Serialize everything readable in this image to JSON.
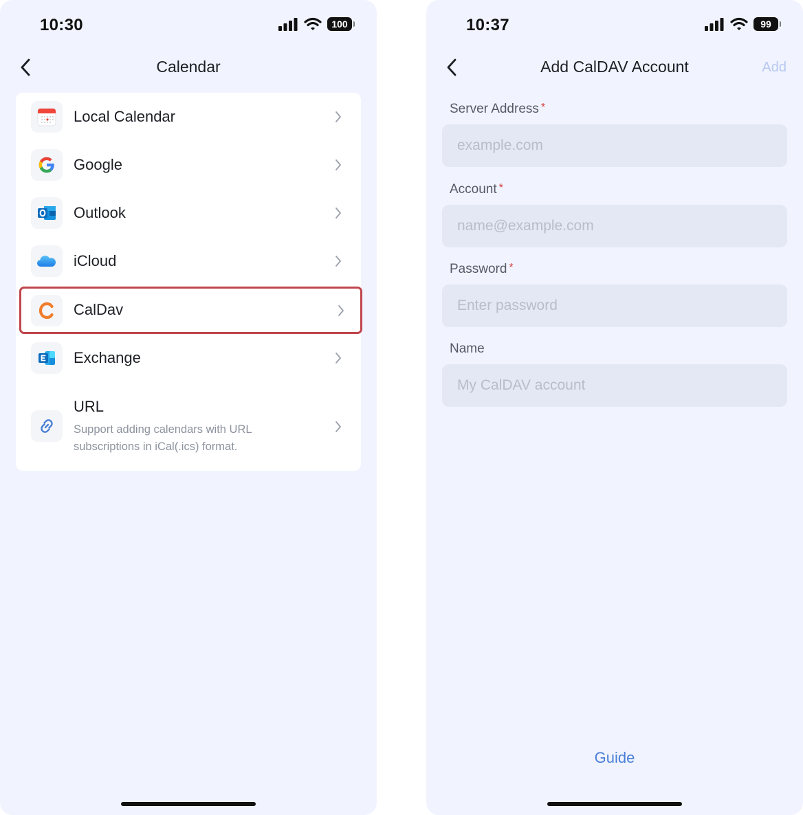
{
  "left_screen": {
    "status": {
      "time": "10:30",
      "battery": "100"
    },
    "nav": {
      "title": "Calendar"
    },
    "items": [
      {
        "label": "Local Calendar",
        "icon": "local-calendar-icon"
      },
      {
        "label": "Google",
        "icon": "google-icon"
      },
      {
        "label": "Outlook",
        "icon": "outlook-icon"
      },
      {
        "label": "iCloud",
        "icon": "icloud-icon"
      },
      {
        "label": "CalDav",
        "icon": "caldav-icon",
        "highlighted": true
      },
      {
        "label": "Exchange",
        "icon": "exchange-icon"
      },
      {
        "label": "URL",
        "icon": "link-icon",
        "description": "Support adding calendars with URL subscriptions in iCal(.ics) format."
      }
    ]
  },
  "right_screen": {
    "status": {
      "time": "10:37",
      "battery": "99"
    },
    "nav": {
      "title": "Add CalDAV Account",
      "action": "Add"
    },
    "fields": [
      {
        "label": "Server Address",
        "required": "*",
        "placeholder": "example.com"
      },
      {
        "label": "Account",
        "required": "*",
        "placeholder": "name@example.com"
      },
      {
        "label": "Password",
        "required": "*",
        "placeholder": "Enter password"
      },
      {
        "label": "Name",
        "required": "",
        "placeholder": "My CalDAV account"
      }
    ],
    "guide_label": "Guide"
  },
  "colors": {
    "background": "#f1f4fe",
    "highlight_border": "#c0454b",
    "link": "#4a7fd8",
    "add_disabled": "#b8c8f0",
    "required": "#d33b3b"
  }
}
